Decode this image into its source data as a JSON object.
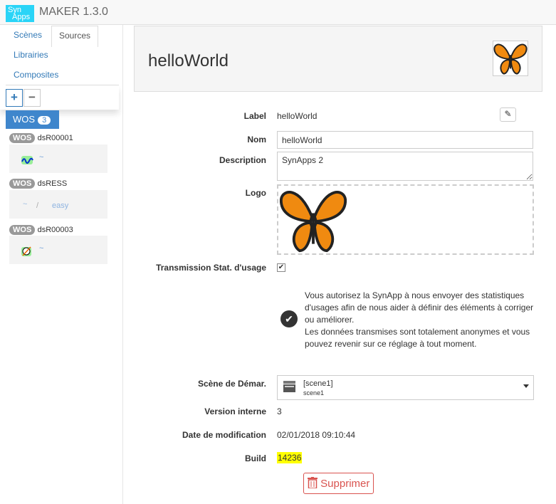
{
  "app": {
    "logo_line1": "Syn",
    "logo_line2": "Apps",
    "title": "MAKER  1.3.0"
  },
  "sidebar": {
    "tabs": [
      {
        "label": "Scènes"
      },
      {
        "label": "Sources"
      },
      {
        "label": "Librairies"
      },
      {
        "label": "Composites"
      }
    ],
    "add_label": "+",
    "remove_label": "−",
    "group": {
      "label": "WOS",
      "count": "3"
    },
    "sources": [
      {
        "tag": "WOS",
        "name": "dsR00001",
        "detail": "~"
      },
      {
        "tag": "WOS",
        "name": "dsRESS",
        "detail": "~",
        "sep": "/",
        "extra": "easy"
      },
      {
        "tag": "WOS",
        "name": "dsR00003",
        "detail": "~"
      }
    ]
  },
  "main": {
    "title": "helloWorld",
    "labels": {
      "label": "Label",
      "nom": "Nom",
      "description": "Description",
      "logo": "Logo",
      "transmission": "Transmission Stat. d'usage",
      "scene": "Scène de Démar.",
      "version": "Version interne",
      "date": "Date de modification",
      "build": "Build"
    },
    "label_value": "helloWorld",
    "nom_value": "helloWorld",
    "description_value": "SynApps 2",
    "transmission_checked": true,
    "info_text": [
      "Vous autorisez la SynApp à nous envoyer des statistiques",
      "d'usages afin de nous aider à définir des éléments à corriger",
      "ou améliorer.",
      "Les données transmises sont totalement anonymes et vous",
      "pouvez revenir sur ce réglage à tout moment."
    ],
    "scene_title": "[scene1]",
    "scene_sub": "scene1",
    "version": "3",
    "date": "02/01/2018 09:10:44",
    "build": "14236",
    "delete_label": "Supprimer"
  }
}
